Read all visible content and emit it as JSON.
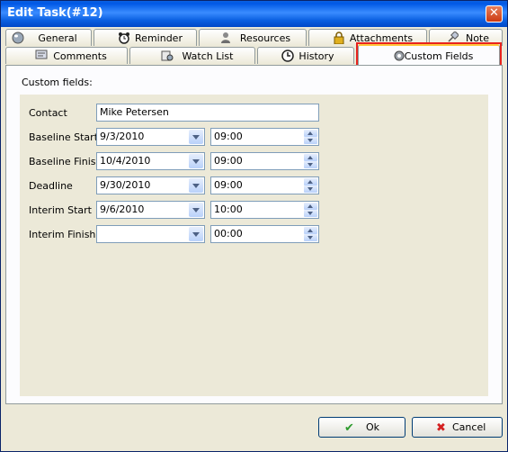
{
  "window": {
    "title": "Edit Task(#12)",
    "close_glyph": "✕"
  },
  "tabs_top": [
    {
      "label": "General",
      "icon": "globe-icon"
    },
    {
      "label": "Reminder",
      "icon": "alarm-clock-icon"
    },
    {
      "label": "Resources",
      "icon": "person-icon"
    },
    {
      "label": "Attachments",
      "icon": "lock-icon"
    },
    {
      "label": "Note",
      "icon": "pin-icon"
    }
  ],
  "tabs_bottom": [
    {
      "label": "Comments",
      "icon": "comments-icon"
    },
    {
      "label": "Watch List",
      "icon": "watch-list-icon"
    },
    {
      "label": "History",
      "icon": "history-icon"
    },
    {
      "label": "Custom Fields",
      "icon": "gear-icon"
    }
  ],
  "selected_tab": "Custom Fields",
  "section_label": "Custom fields:",
  "contact": {
    "label": "Contact",
    "value": "Mike Petersen"
  },
  "date_rows": [
    {
      "label": "Baseline Start",
      "date": "9/3/2010",
      "time": "09:00"
    },
    {
      "label": "Baseline Finish",
      "date": "10/4/2010",
      "time": "09:00"
    },
    {
      "label": "Deadline",
      "date": "9/30/2010",
      "time": "09:00"
    },
    {
      "label": "Interim Start",
      "date": "9/6/2010",
      "time": "10:00"
    },
    {
      "label": "Interim Finish",
      "date": "",
      "time": "00:00"
    }
  ],
  "buttons": {
    "ok_label": "Ok",
    "ok_glyph": "✔",
    "cancel_label": "Cancel",
    "cancel_glyph": "✖"
  },
  "colors": {
    "title_bar": "#0a5fe0",
    "highlight": "#e8231d",
    "ok_check": "#2e9b2e",
    "cancel_x": "#d42020"
  }
}
